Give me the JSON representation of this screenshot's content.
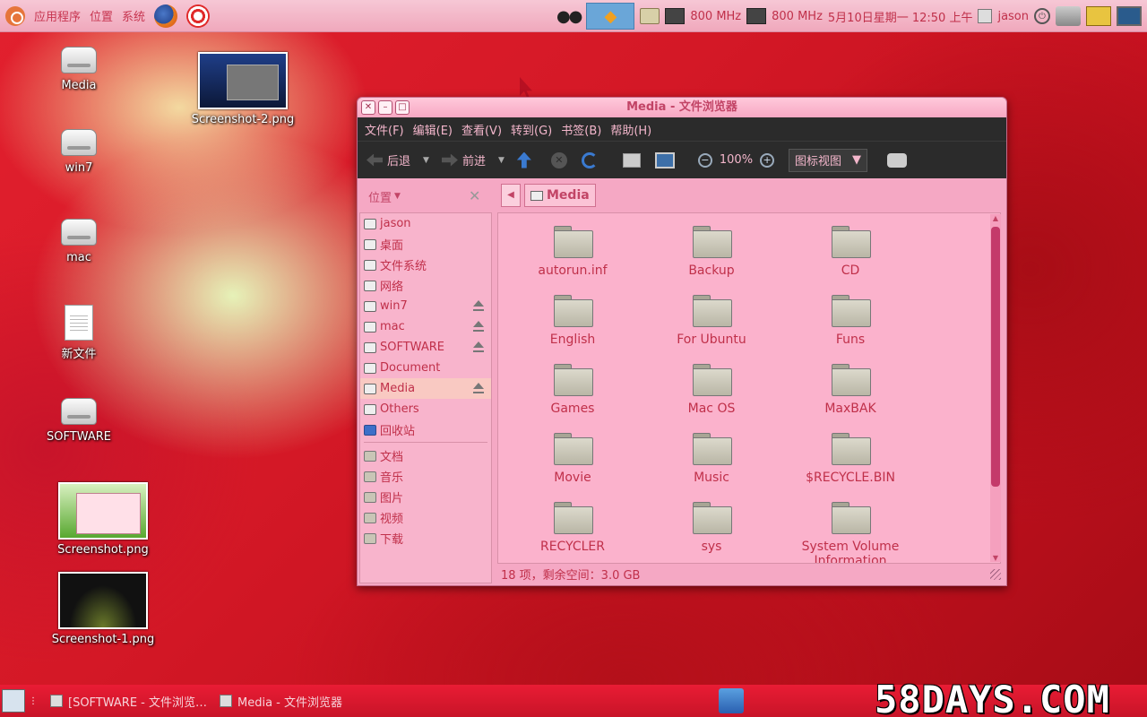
{
  "top_panel": {
    "menus": [
      "应用程序",
      "位置",
      "系统"
    ],
    "cpu1": "800 MHz",
    "cpu2": "800 MHz",
    "clock": "5月10日星期一 12:50 上午",
    "user": "jason"
  },
  "desktop_icons": [
    {
      "label": "Media",
      "kind": "drive"
    },
    {
      "label": "win7",
      "kind": "drive"
    },
    {
      "label": "mac",
      "kind": "drive"
    },
    {
      "label": "新文件",
      "kind": "document"
    },
    {
      "label": "SOFTWARE",
      "kind": "drive"
    },
    {
      "label": "Screenshot-2.png",
      "kind": "image"
    },
    {
      "label": "Screenshot.png",
      "kind": "image"
    },
    {
      "label": "Screenshot-1.png",
      "kind": "image"
    }
  ],
  "window": {
    "title": "Media - 文件浏览器",
    "menu": [
      "文件(F)",
      "编辑(E)",
      "查看(V)",
      "转到(G)",
      "书签(B)",
      "帮助(H)"
    ],
    "toolbar": {
      "back": "后退",
      "forward": "前进",
      "zoom": "100%",
      "view_mode": "图标视图"
    },
    "sidebar_title": "位置",
    "sidebar": [
      {
        "label": "jason",
        "icon": "home-icon",
        "eject": false
      },
      {
        "label": "桌面",
        "icon": "desktop-icon",
        "eject": false
      },
      {
        "label": "文件系统",
        "icon": "drive-icon",
        "eject": false
      },
      {
        "label": "网络",
        "icon": "network-icon",
        "eject": false
      },
      {
        "label": "win7",
        "icon": "drive-icon",
        "eject": true
      },
      {
        "label": "mac",
        "icon": "drive-icon",
        "eject": true
      },
      {
        "label": "SOFTWARE",
        "icon": "drive-icon",
        "eject": true
      },
      {
        "label": "Document",
        "icon": "drive-icon",
        "eject": false
      },
      {
        "label": "Media",
        "icon": "drive-icon",
        "eject": true,
        "selected": true
      },
      {
        "label": "Others",
        "icon": "drive-icon",
        "eject": false
      },
      {
        "label": "回收站",
        "icon": "trash-icon",
        "eject": false
      }
    ],
    "bookmarks": [
      "文档",
      "音乐",
      "图片",
      "视频",
      "下载"
    ],
    "location": "Media",
    "files": [
      "autorun.inf",
      "Backup",
      "CD",
      "English",
      "For Ubuntu",
      "Funs",
      "Games",
      "Mac OS",
      "MaxBAK",
      "Movie",
      "Music",
      "$RECYCLE.BIN",
      "RECYCLER",
      "sys",
      "System Volume Information"
    ],
    "status": "18 项，剩余空间：3.0 GB"
  },
  "bottom_panel": {
    "tasks": [
      "[SOFTWARE - 文件浏览…",
      "Media - 文件浏览器"
    ]
  },
  "watermark": "58DAYS.COM",
  "colors": {
    "accent_text": "#c0304a",
    "window_bg": "#f5a8c4",
    "menubar_bg": "#2b2b2b",
    "bottom_panel": "#d8182e"
  }
}
